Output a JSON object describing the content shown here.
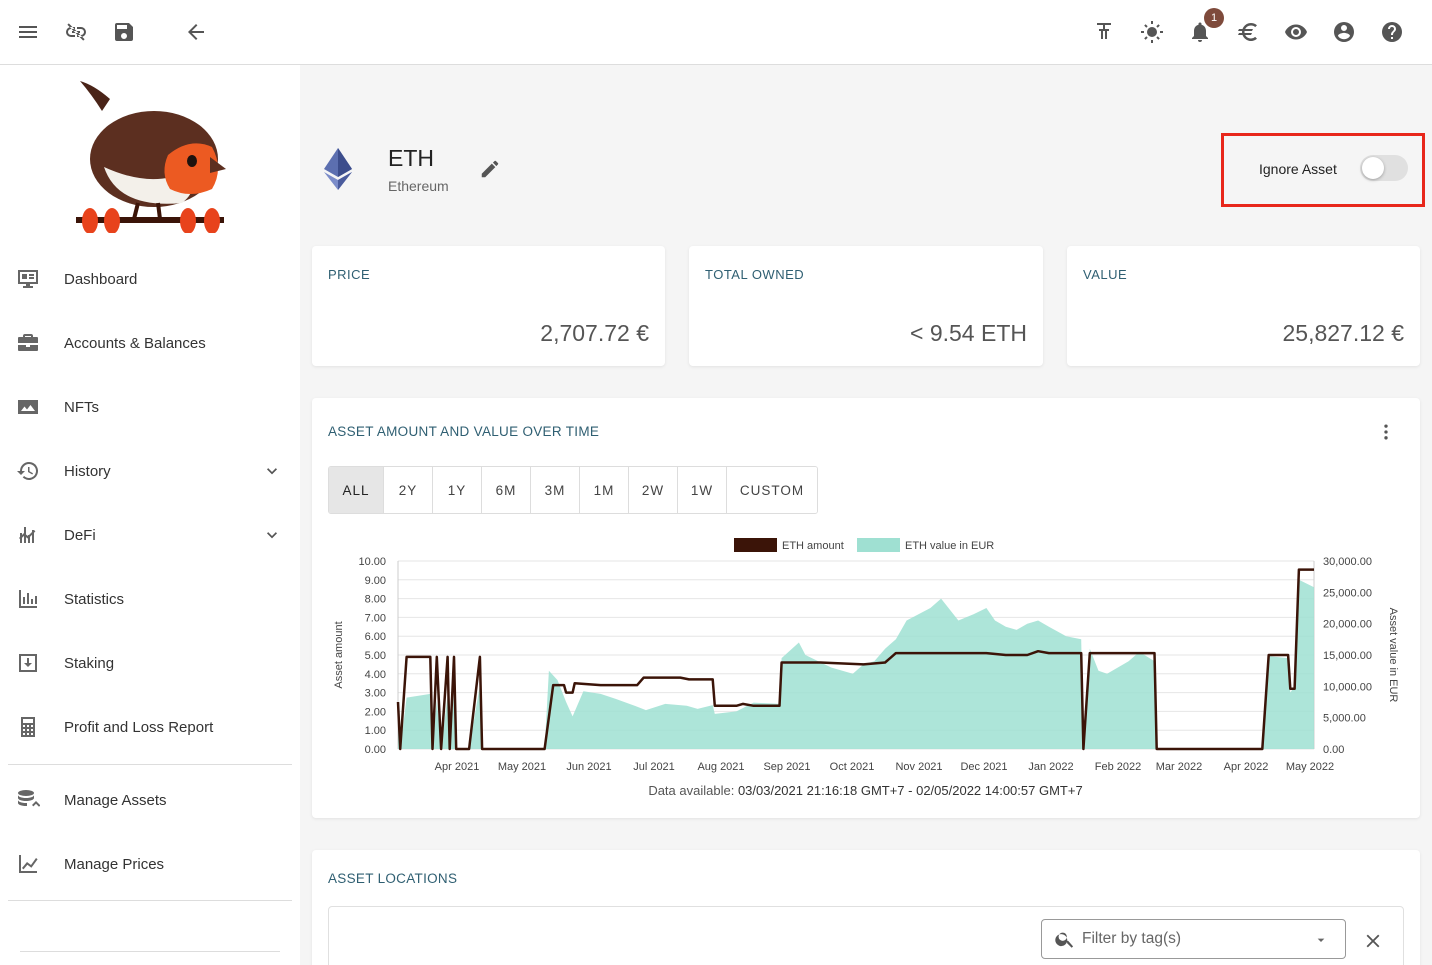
{
  "topbar": {
    "icons": [
      "menu-icon",
      "link-off-icon",
      "save-icon",
      "arrow-back-icon",
      "pinned-icon",
      "theme-icon",
      "bell-icon",
      "euro-icon",
      "eye-icon",
      "account-icon",
      "help-icon"
    ],
    "notification_count": "1"
  },
  "sidebar": {
    "items": [
      {
        "label": "Dashboard",
        "icon": "dashboard-icon"
      },
      {
        "label": "Accounts & Balances",
        "icon": "briefcase-icon"
      },
      {
        "label": "NFTs",
        "icon": "image-icon"
      },
      {
        "label": "History",
        "icon": "history-icon",
        "expandable": true
      },
      {
        "label": "DeFi",
        "icon": "defi-icon",
        "expandable": true
      },
      {
        "label": "Statistics",
        "icon": "statistics-icon"
      },
      {
        "label": "Staking",
        "icon": "staking-icon"
      },
      {
        "label": "Profit and Loss Report",
        "icon": "calculator-icon"
      }
    ],
    "secondary_items": [
      {
        "label": "Manage Assets",
        "icon": "manage-assets-icon"
      },
      {
        "label": "Manage Prices",
        "icon": "manage-prices-icon"
      }
    ]
  },
  "asset": {
    "symbol": "ETH",
    "name": "Ethereum",
    "ignore_label": "Ignore Asset",
    "ignored": false
  },
  "stats": [
    {
      "title": "PRICE",
      "value": "2,707.72 €"
    },
    {
      "title": "TOTAL OWNED",
      "value": "< 9.54 ETH"
    },
    {
      "title": "VALUE",
      "value": "25,827.12 €"
    }
  ],
  "chart_card": {
    "title": "ASSET AMOUNT AND VALUE OVER TIME",
    "ranges": [
      "ALL",
      "2Y",
      "1Y",
      "6M",
      "3M",
      "1M",
      "2W",
      "1W",
      "CUSTOM"
    ],
    "active_range": "ALL",
    "data_available_label": "Data available:",
    "data_available_range": "03/03/2021 21:16:18 GMT+7 - 02/05/2022 14:00:57 GMT+7"
  },
  "locations": {
    "title": "ASSET LOCATIONS",
    "filter_placeholder": "Filter by tag(s)"
  },
  "colors": {
    "amount_line": "#3b1408",
    "value_area": "#9fe0d2",
    "section_title": "#2f5f72",
    "highlight": "#e8271b"
  },
  "chart_data": {
    "type": "line",
    "x_ticks": [
      "Apr 2021",
      "May 2021",
      "Jun 2021",
      "Jul 2021",
      "Aug 2021",
      "Sep 2021",
      "Oct 2021",
      "Nov 2021",
      "Dec 2021",
      "Jan 2022",
      "Feb 2022",
      "Mar 2022",
      "Apr 2022",
      "May 2022"
    ],
    "y_left_label": "Asset amount",
    "y_right_label": "Asset value in EUR",
    "y_left_ticks": [
      "0.00",
      "1.00",
      "2.00",
      "3.00",
      "4.00",
      "5.00",
      "6.00",
      "7.00",
      "8.00",
      "9.00",
      "10.00"
    ],
    "y_right_ticks": [
      "0.00",
      "5,000.00",
      "10,000.00",
      "15,000.00",
      "20,000.00",
      "25,000.00",
      "30,000.00"
    ],
    "ylim_left": [
      0,
      10
    ],
    "ylim_right": [
      0,
      30000
    ],
    "legend": [
      "ETH amount",
      "ETH value in EUR"
    ],
    "legend_position": "top-center",
    "series": [
      {
        "name": "ETH amount",
        "type": "step",
        "points": [
          [
            "2021-03-03",
            2.5
          ],
          [
            "2021-03-04",
            0
          ],
          [
            "2021-03-07",
            4.9
          ],
          [
            "2021-03-18",
            4.9
          ],
          [
            "2021-03-19",
            0
          ],
          [
            "2021-03-21",
            4.9
          ],
          [
            "2021-03-23",
            0
          ],
          [
            "2021-03-26",
            4.9
          ],
          [
            "2021-03-27",
            0
          ],
          [
            "2021-03-29",
            4.9
          ],
          [
            "2021-03-30",
            0
          ],
          [
            "2021-04-05",
            0
          ],
          [
            "2021-04-10",
            4.9
          ],
          [
            "2021-04-11",
            0
          ],
          [
            "2021-05-10",
            0
          ],
          [
            "2021-05-14",
            3.4
          ],
          [
            "2021-05-19",
            3.4
          ],
          [
            "2021-05-20",
            3.0
          ],
          [
            "2021-05-23",
            3.0
          ],
          [
            "2021-05-24",
            3.5
          ],
          [
            "2021-06-05",
            3.4
          ],
          [
            "2021-06-22",
            3.4
          ],
          [
            "2021-06-25",
            3.8
          ],
          [
            "2021-07-12",
            3.8
          ],
          [
            "2021-07-16",
            3.7
          ],
          [
            "2021-07-27",
            3.7
          ],
          [
            "2021-07-28",
            2.3
          ],
          [
            "2021-08-07",
            2.3
          ],
          [
            "2021-08-10",
            2.4
          ],
          [
            "2021-08-15",
            2.3
          ],
          [
            "2021-08-27",
            2.3
          ],
          [
            "2021-08-28",
            4.6
          ],
          [
            "2021-09-15",
            4.6
          ],
          [
            "2021-10-05",
            4.5
          ],
          [
            "2021-10-15",
            4.6
          ],
          [
            "2021-10-20",
            5.1
          ],
          [
            "2021-11-15",
            5.1
          ],
          [
            "2021-12-01",
            5.1
          ],
          [
            "2021-12-10",
            5.0
          ],
          [
            "2021-12-20",
            5.0
          ],
          [
            "2021-12-25",
            5.2
          ],
          [
            "2021-12-30",
            5.1
          ],
          [
            "2022-01-14",
            5.1
          ],
          [
            "2022-01-15",
            0
          ],
          [
            "2022-01-18",
            5.1
          ],
          [
            "2022-02-17",
            5.1
          ],
          [
            "2022-02-18",
            0
          ],
          [
            "2022-04-08",
            0
          ],
          [
            "2022-04-11",
            5.0
          ],
          [
            "2022-04-20",
            5.0
          ],
          [
            "2022-04-21",
            3.2
          ],
          [
            "2022-04-23",
            3.2
          ],
          [
            "2022-04-25",
            9.54
          ],
          [
            "2022-05-02",
            9.54
          ]
        ]
      },
      {
        "name": "ETH value in EUR",
        "type": "area",
        "points": [
          [
            "2021-03-03",
            4700
          ],
          [
            "2021-03-04",
            0
          ],
          [
            "2021-03-07",
            8200
          ],
          [
            "2021-03-18",
            8800
          ],
          [
            "2021-03-19",
            0
          ],
          [
            "2021-03-21",
            7800
          ],
          [
            "2021-03-23",
            0
          ],
          [
            "2021-03-26",
            8500
          ],
          [
            "2021-03-27",
            0
          ],
          [
            "2021-03-29",
            9100
          ],
          [
            "2021-03-30",
            0
          ],
          [
            "2021-04-05",
            0
          ],
          [
            "2021-04-10",
            10200
          ],
          [
            "2021-04-11",
            0
          ],
          [
            "2021-05-10",
            0
          ],
          [
            "2021-05-12",
            12500
          ],
          [
            "2021-05-16",
            11000
          ],
          [
            "2021-05-20",
            7500
          ],
          [
            "2021-05-23",
            5200
          ],
          [
            "2021-05-28",
            9200
          ],
          [
            "2021-06-05",
            8800
          ],
          [
            "2021-06-12",
            8000
          ],
          [
            "2021-06-20",
            7000
          ],
          [
            "2021-06-26",
            6200
          ],
          [
            "2021-07-05",
            7200
          ],
          [
            "2021-07-15",
            6900
          ],
          [
            "2021-07-20",
            6400
          ],
          [
            "2021-07-27",
            7000
          ],
          [
            "2021-07-28",
            5600
          ],
          [
            "2021-08-07",
            6000
          ],
          [
            "2021-08-15",
            7400
          ],
          [
            "2021-08-27",
            7200
          ],
          [
            "2021-08-28",
            14500
          ],
          [
            "2021-09-05",
            17000
          ],
          [
            "2021-09-08",
            15000
          ],
          [
            "2021-09-20",
            13000
          ],
          [
            "2021-09-30",
            12000
          ],
          [
            "2021-10-05",
            13500
          ],
          [
            "2021-10-10",
            14000
          ],
          [
            "2021-10-15",
            16000
          ],
          [
            "2021-10-20",
            17500
          ],
          [
            "2021-10-25",
            20500
          ],
          [
            "2021-11-05",
            22500
          ],
          [
            "2021-11-10",
            24000
          ],
          [
            "2021-11-18",
            20500
          ],
          [
            "2021-11-25",
            21500
          ],
          [
            "2021-12-01",
            22500
          ],
          [
            "2021-12-05",
            20500
          ],
          [
            "2021-12-10",
            19500
          ],
          [
            "2021-12-15",
            19000
          ],
          [
            "2021-12-20",
            20000
          ],
          [
            "2021-12-25",
            20500
          ],
          [
            "2021-12-30",
            19500
          ],
          [
            "2022-01-07",
            18000
          ],
          [
            "2022-01-14",
            17500
          ],
          [
            "2022-01-15",
            0
          ],
          [
            "2022-01-18",
            16000
          ],
          [
            "2022-01-22",
            12500
          ],
          [
            "2022-01-26",
            12000
          ],
          [
            "2022-02-05",
            14000
          ],
          [
            "2022-02-10",
            15500
          ],
          [
            "2022-02-17",
            14000
          ],
          [
            "2022-02-18",
            0
          ],
          [
            "2022-04-08",
            0
          ],
          [
            "2022-04-11",
            14800
          ],
          [
            "2022-04-20",
            14500
          ],
          [
            "2022-04-21",
            9000
          ],
          [
            "2022-04-23",
            10000
          ],
          [
            "2022-04-25",
            27000
          ],
          [
            "2022-05-02",
            25800
          ]
        ]
      }
    ]
  }
}
